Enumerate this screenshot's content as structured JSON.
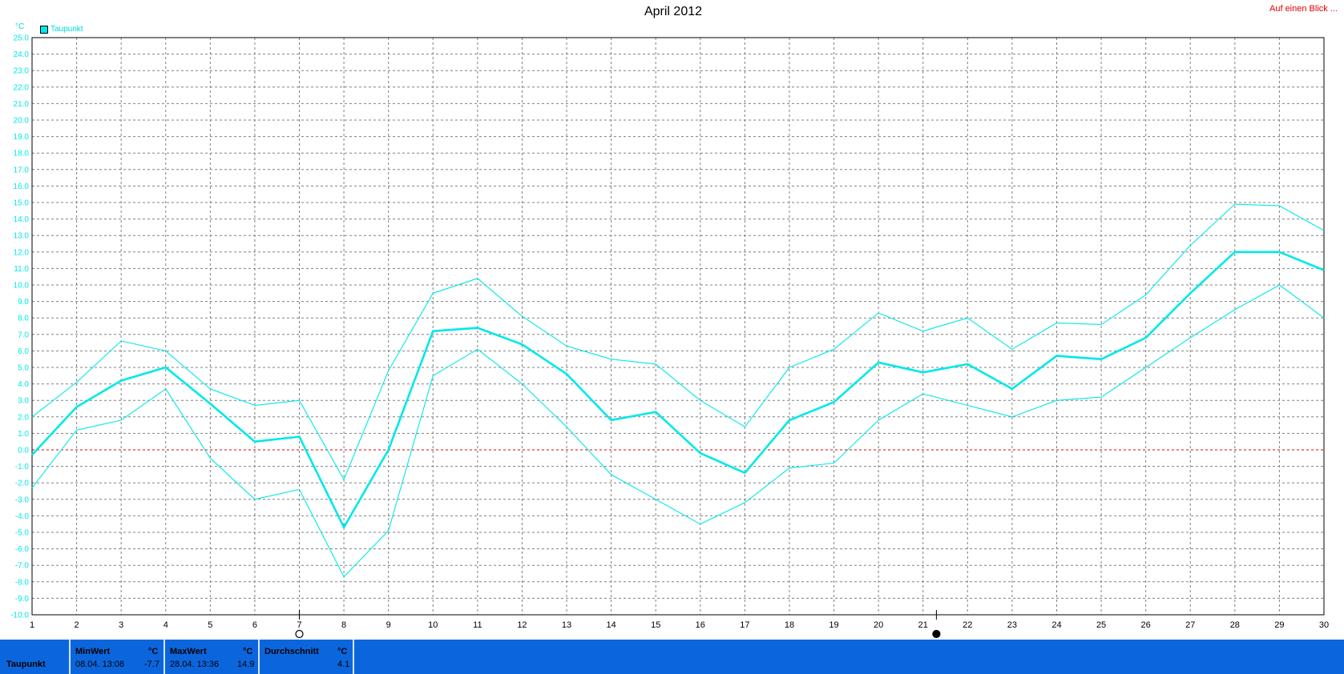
{
  "title": "April 2012",
  "glance_link": "Auf einen Blick ...",
  "unit_label": "°C",
  "legend": {
    "label": "Taupunkt",
    "color": "#00e8e8"
  },
  "colors": {
    "series": "#00e8e8",
    "zero_line": "#e00000",
    "grid": "#808080",
    "footer": "#0b66dd"
  },
  "chart_data": {
    "type": "line",
    "title": "April 2012",
    "ylabel": "°C",
    "xlabel": "",
    "ylim": [
      -10,
      25
    ],
    "ytick_step": 1,
    "grid": true,
    "legend_position": "top-left",
    "x": [
      1,
      2,
      3,
      4,
      5,
      6,
      7,
      8,
      9,
      10,
      11,
      12,
      13,
      14,
      15,
      16,
      17,
      18,
      19,
      20,
      21,
      22,
      23,
      24,
      25,
      26,
      27,
      28,
      29,
      30
    ],
    "series": [
      {
        "name": "Taupunkt",
        "values": [
          -0.3,
          2.6,
          4.2,
          5.0,
          2.8,
          0.5,
          0.8,
          -4.7,
          0.0,
          7.2,
          7.4,
          6.4,
          4.6,
          1.8,
          2.3,
          -0.2,
          -1.4,
          1.8,
          2.9,
          5.3,
          4.7,
          5.2,
          3.7,
          5.7,
          5.5,
          6.8,
          9.5,
          12.0,
          12.0,
          10.9
        ],
        "bold": true
      },
      {
        "name": "",
        "values": [
          2.0,
          4.1,
          6.6,
          6.0,
          3.7,
          2.7,
          3.0,
          -1.8,
          4.8,
          9.5,
          10.4,
          8.1,
          6.3,
          5.5,
          5.2,
          3.0,
          1.4,
          5.0,
          6.1,
          8.3,
          7.2,
          8.0,
          6.1,
          7.7,
          7.6,
          9.4,
          12.4,
          14.9,
          14.8,
          13.3
        ]
      },
      {
        "name": "",
        "values": [
          -2.3,
          1.2,
          1.8,
          3.7,
          -0.5,
          -3.0,
          -2.4,
          -7.7,
          -4.9,
          4.5,
          6.1,
          4.0,
          1.4,
          -1.5,
          -3.0,
          -4.5,
          -3.2,
          -1.1,
          -0.8,
          1.8,
          3.4,
          2.7,
          2.0,
          3.0,
          3.2,
          5.0,
          6.8,
          8.5,
          10.0,
          8.0
        ]
      }
    ],
    "markers": [
      {
        "x": 7,
        "symbol": "full-moon"
      },
      {
        "x": 21.3,
        "symbol": "new-moon"
      }
    ]
  },
  "stats": {
    "row_label": "Taupunkt",
    "min": {
      "header": "MinWert",
      "unit": "°C",
      "time": "08.04.  13:08",
      "value": "-7.7"
    },
    "max": {
      "header": "MaxWert",
      "unit": "°C",
      "time": "28.04.  13:36",
      "value": "14.9"
    },
    "avg": {
      "header": "Durchschnitt",
      "unit": "°C",
      "value": "4.1"
    }
  }
}
